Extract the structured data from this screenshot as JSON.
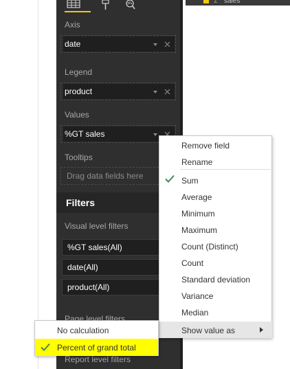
{
  "canvas": {
    "visual_field": "sales"
  },
  "pane": {
    "sections": {
      "axis": {
        "label": "Axis",
        "field": "date"
      },
      "legend": {
        "label": "Legend",
        "field": "product"
      },
      "values": {
        "label": "Values",
        "field": "%GT sales"
      },
      "tooltips": {
        "label": "Tooltips",
        "placeholder": "Drag data fields here"
      }
    },
    "filters": {
      "header": "Filters",
      "visual_level_label": "Visual level filters",
      "cards": [
        "%GT sales(All)",
        "date(All)",
        "product(All)"
      ],
      "page_level_label": "Page level filters",
      "report_level_label": "Report level filters"
    }
  },
  "context_menu": {
    "items": [
      "Remove field",
      "Rename",
      "Sum",
      "Average",
      "Minimum",
      "Maximum",
      "Count (Distinct)",
      "Count",
      "Standard deviation",
      "Variance",
      "Median",
      "Show value as"
    ],
    "checked_item": "Sum"
  },
  "submenu": {
    "items": [
      "No calculation",
      "Percent of grand total"
    ],
    "checked_item": "Percent of grand total"
  },
  "colors": {
    "pane_bg": "#2f2f2f",
    "accent_yellow": "#f2c811",
    "highlight_yellow": "#ffff00",
    "check_green": "#3f8a5d"
  }
}
